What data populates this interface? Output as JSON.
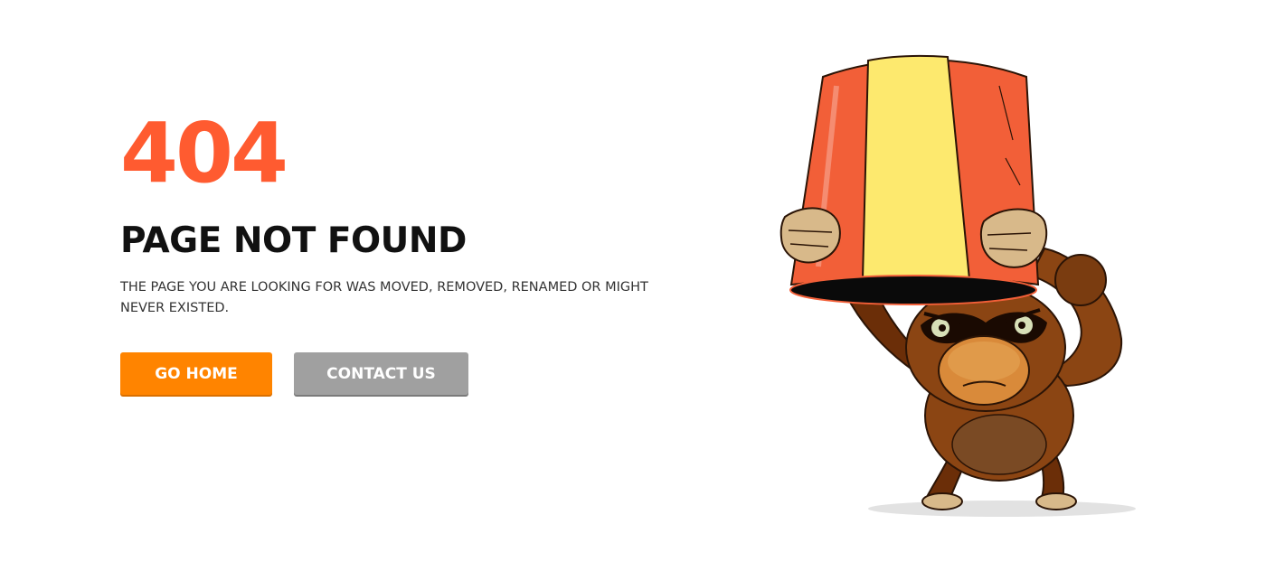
{
  "error": {
    "code": "404",
    "title": "PAGE NOT FOUND",
    "description": "THE PAGE YOU ARE LOOKING FOR WAS MOVED, REMOVED, RENAMED OR MIGHT NEVER EXISTED."
  },
  "buttons": {
    "home_label": "GO HOME",
    "contact_label": "CONTACT US"
  },
  "colors": {
    "accent": "#ff5b30",
    "home_button": "#ff8400",
    "contact_button": "#a0a0a0",
    "title": "#111111"
  },
  "illustration": {
    "subject": "monkey-with-bucket-on-head"
  }
}
